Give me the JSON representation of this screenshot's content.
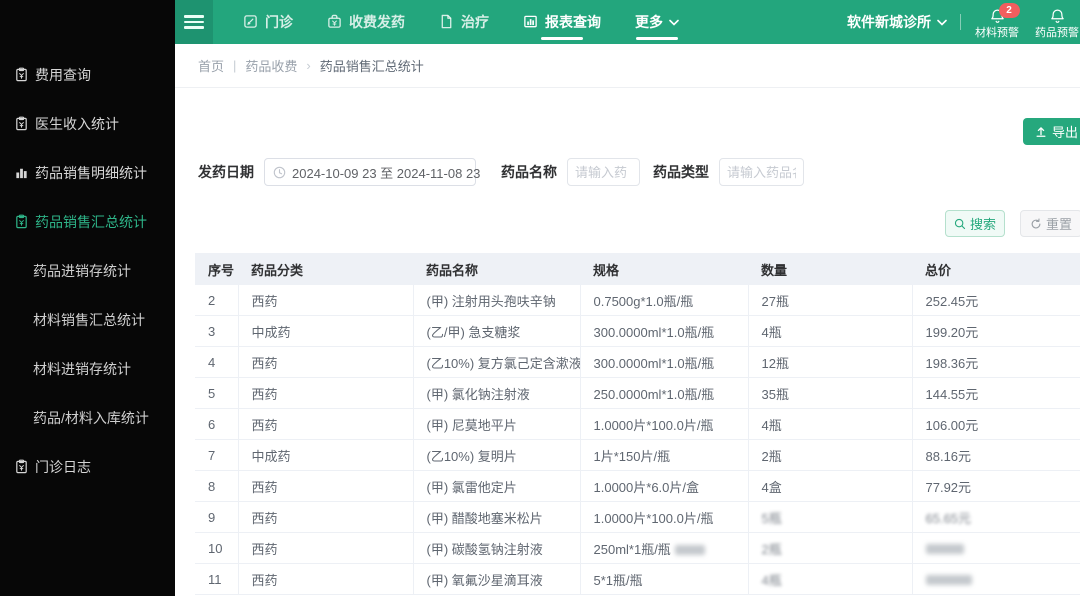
{
  "colors": {
    "nav_green": "#23a67d",
    "nav_green_dark": "#1e9370",
    "sidebar_bg": "#070707",
    "active_green": "#2eb488",
    "btn_green": "#26a87d",
    "badge_red": "#f25e5e",
    "table_header_bg": "#eef1f6"
  },
  "navbar": {
    "items": [
      {
        "label": "门诊",
        "icon": "outpatient-icon",
        "active": false
      },
      {
        "label": "收费发药",
        "icon": "charge-dispense-icon",
        "active": false
      },
      {
        "label": "治疗",
        "icon": "treatment-icon",
        "active": false
      },
      {
        "label": "报表查询",
        "icon": "report-query-icon",
        "active": true
      },
      {
        "label": "更多",
        "icon": "",
        "chevron": true,
        "active": true
      }
    ],
    "clinic_name": "软件新城诊所",
    "alerts": [
      {
        "label": "材料预警",
        "badge": "2"
      },
      {
        "label": "药品预警",
        "badge": ""
      }
    ]
  },
  "sidebar": {
    "items": [
      {
        "label": "费用查询",
        "icon": "fee-clipboard-icon",
        "active": false,
        "sub": false
      },
      {
        "label": "医生收入统计",
        "icon": "fee-clipboard-icon",
        "active": false,
        "sub": false
      },
      {
        "label": "药品销售明细统计",
        "icon": "bar-chart-icon",
        "active": false,
        "sub": false
      },
      {
        "label": "药品销售汇总统计",
        "icon": "fee-clipboard-icon",
        "active": true,
        "sub": false
      },
      {
        "label": "药品进销存统计",
        "icon": "",
        "active": false,
        "sub": true
      },
      {
        "label": "材料销售汇总统计",
        "icon": "",
        "active": false,
        "sub": true
      },
      {
        "label": "材料进销存统计",
        "icon": "",
        "active": false,
        "sub": true
      },
      {
        "label": "药品/材料入库统计",
        "icon": "",
        "active": false,
        "sub": true
      },
      {
        "label": "门诊日志",
        "icon": "fee-clipboard-icon",
        "active": false,
        "sub": false
      }
    ]
  },
  "breadcrumb": {
    "items": [
      "首页",
      "药品收费",
      "药品销售汇总统计"
    ],
    "separators": [
      "|",
      "›"
    ]
  },
  "toolbar": {
    "export_label": "导出"
  },
  "filters": {
    "date_label": "发药日期",
    "date_value": "2024-10-09 23 至 2024-11-08 23",
    "drug_name_label": "药品名称",
    "drug_name_placeholder": "请输入药",
    "drug_type_label": "药品类型",
    "drug_type_placeholder": "请输入药品名称",
    "search_label": "搜索",
    "reset_label": "重置"
  },
  "table": {
    "columns": [
      "序号",
      "药品分类",
      "药品名称",
      "规格",
      "数量",
      "总价"
    ],
    "rows": [
      {
        "no": "2",
        "cat": "西药",
        "name": "(甲) 注射用头孢呋辛钠",
        "spec": "0.7500g*1.0瓶/瓶",
        "qty": "27瓶",
        "total": "252.45元"
      },
      {
        "no": "3",
        "cat": "中成药",
        "name": "(乙/甲) 急支糖浆",
        "spec": "300.0000ml*1.0瓶/瓶",
        "qty": "4瓶",
        "total": "199.20元"
      },
      {
        "no": "4",
        "cat": "西药",
        "name": "(乙10%) 复方氯己定含漱液",
        "spec": "300.0000ml*1.0瓶/瓶",
        "qty": "12瓶",
        "total": "198.36元"
      },
      {
        "no": "5",
        "cat": "西药",
        "name": "(甲) 氯化钠注射液",
        "spec": "250.0000ml*1.0瓶/瓶",
        "qty": "35瓶",
        "total": "144.55元"
      },
      {
        "no": "6",
        "cat": "西药",
        "name": "(甲) 尼莫地平片",
        "spec": "1.0000片*100.0片/瓶",
        "qty": "4瓶",
        "total": "106.00元"
      },
      {
        "no": "7",
        "cat": "中成药",
        "name": "(乙10%) 复明片",
        "spec": "1片*150片/瓶",
        "qty": "2瓶",
        "total": "88.16元"
      },
      {
        "no": "8",
        "cat": "西药",
        "name": "(甲) 氯雷他定片",
        "spec": "1.0000片*6.0片/盒",
        "qty": "4盒",
        "total": "77.92元"
      },
      {
        "no": "9",
        "cat": "西药",
        "name": "(甲) 醋酸地塞米松片",
        "spec": "1.0000片*100.0片/瓶",
        "qty": "5瓶",
        "total": "65.65元",
        "qty_blur": true,
        "total_blur": true
      },
      {
        "no": "10",
        "cat": "西药",
        "name": "(甲) 碳酸氢钠注射液",
        "spec": "250ml*1瓶/瓶",
        "spec_blob": 30,
        "qty": "2瓶",
        "total": "",
        "qty_blur": true,
        "total_blob": 38
      },
      {
        "no": "11",
        "cat": "西药",
        "name": "(甲) 氧氟沙星滴耳液",
        "spec": "5*1瓶/瓶",
        "qty": "4瓶",
        "total": "",
        "qty_blur": true,
        "total_blob": 46
      }
    ]
  }
}
